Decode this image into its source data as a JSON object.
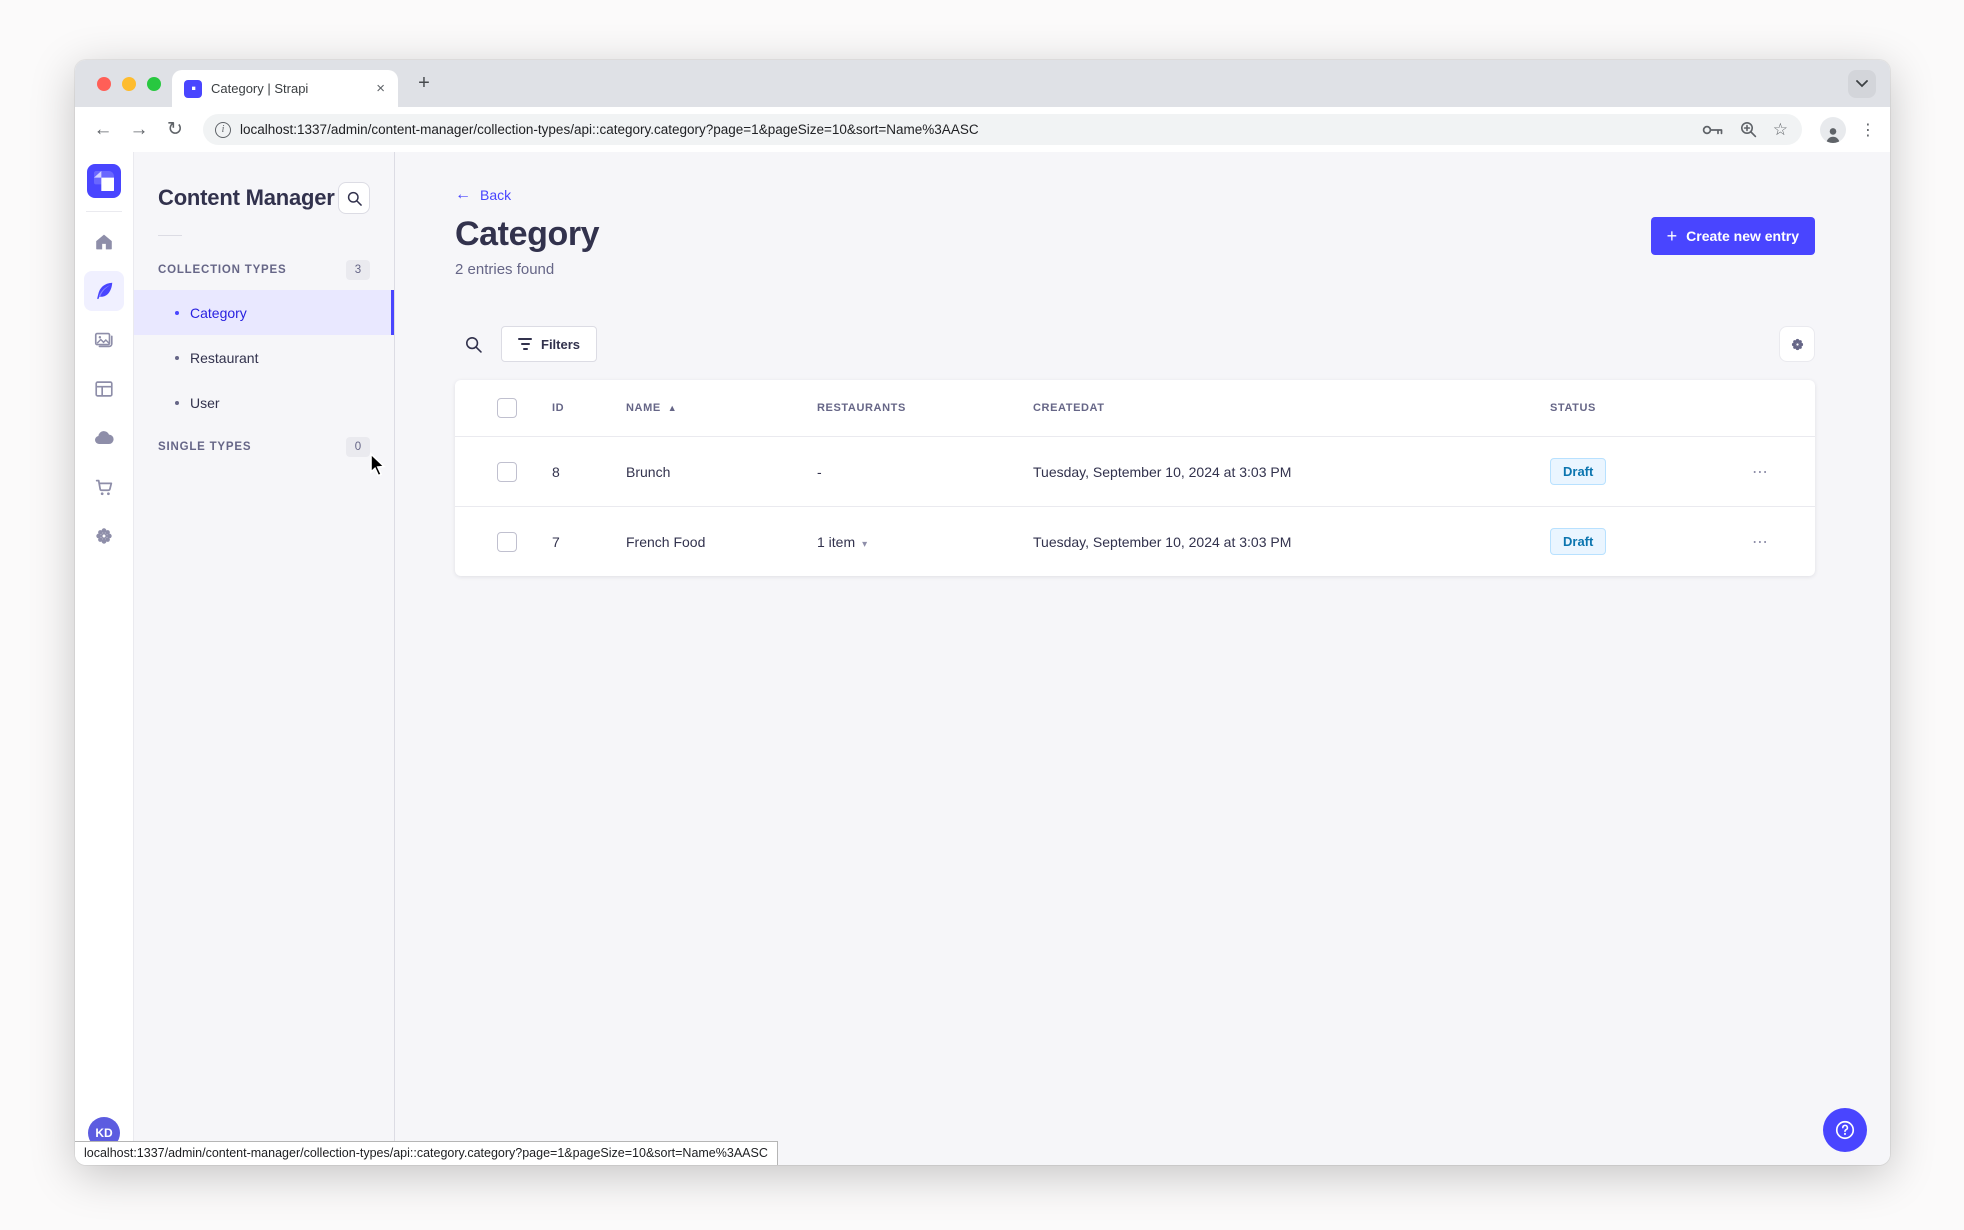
{
  "browser": {
    "tab_title": "Category | Strapi",
    "url": "localhost:1337/admin/content-manager/collection-types/api::category.category?page=1&pageSize=10&sort=Name%3AASC",
    "status_url": "localhost:1337/admin/content-manager/collection-types/api::category.category?page=1&pageSize=10&sort=Name%3AASC"
  },
  "icons": {
    "back_arrow": "←",
    "forward_arrow": "→",
    "reload": "↻",
    "star": "☆",
    "kebab": "⋮",
    "tab_close": "×",
    "new_tab": "+",
    "plus": "+",
    "app_back_arrow": "←",
    "sort_asc": "▲",
    "caret_down": "▾",
    "row_dots": "⋯",
    "info": "i"
  },
  "subnav": {
    "title": "Content Manager",
    "sections": [
      {
        "label": "COLLECTION TYPES",
        "badge": "3",
        "items": [
          {
            "label": "Category",
            "active": true
          },
          {
            "label": "Restaurant",
            "active": false
          },
          {
            "label": "User",
            "active": false
          }
        ]
      },
      {
        "label": "SINGLE TYPES",
        "badge": "0",
        "items": []
      }
    ]
  },
  "main": {
    "back_label": "Back",
    "title": "Category",
    "subtitle": "2 entries found",
    "create_button_label": "Create new entry",
    "filters_label": "Filters",
    "table": {
      "columns": [
        "ID",
        "NAME",
        "RESTAURANTS",
        "CREATEDAT",
        "STATUS"
      ],
      "rows": [
        {
          "id": "8",
          "name": "Brunch",
          "restaurants": "-",
          "has_rest_dropdown": false,
          "created_at": "Tuesday, September 10, 2024 at 3:03 PM",
          "status": "Draft"
        },
        {
          "id": "7",
          "name": "French Food",
          "restaurants": "1 item",
          "has_rest_dropdown": true,
          "created_at": "Tuesday, September 10, 2024 at 3:03 PM",
          "status": "Draft"
        }
      ]
    }
  },
  "user": {
    "initials": "KD"
  },
  "colors": {
    "primary": "#4945ff",
    "primary_dark_text": "#271fe0",
    "active_item_bg": "#e9e8ff",
    "draft_bg": "#eaf5ff",
    "draft_border": "#b8e1ff",
    "draft_text": "#0c75af",
    "app_bg": "#f6f6f9"
  }
}
